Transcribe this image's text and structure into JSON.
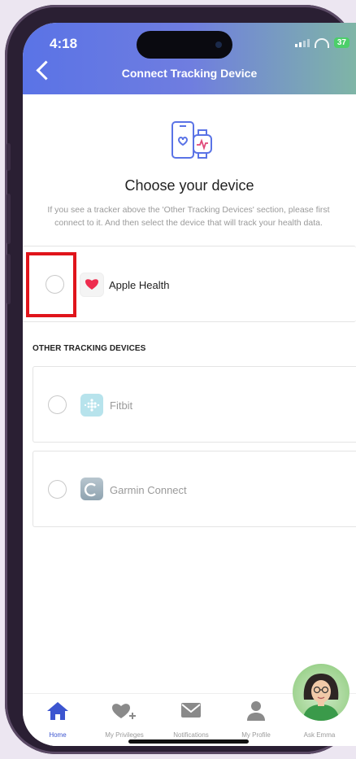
{
  "status_bar": {
    "time": "4:18",
    "battery": "37"
  },
  "header": {
    "title": "Connect Tracking Device"
  },
  "main": {
    "heading": "Choose your device",
    "description": "If you see a tracker above the 'Other Tracking Devices' section, please first connect to it. And then select the device that will track your health data.",
    "primary_device": {
      "label": "Apple Health",
      "selected": false
    },
    "other_section_title": "OTHER TRACKING DEVICES",
    "other_devices": [
      {
        "label": "Fitbit",
        "selected": false
      },
      {
        "label": "Garmin Connect",
        "selected": false
      }
    ]
  },
  "tabbar": {
    "tabs": [
      {
        "label": "Home",
        "icon": "home-icon",
        "active": true
      },
      {
        "label": "My Privileges",
        "icon": "heart-plus-icon",
        "active": false
      },
      {
        "label": "Notifications",
        "icon": "envelope-icon",
        "active": false
      },
      {
        "label": "My Profile",
        "icon": "person-icon",
        "active": false
      },
      {
        "label": "Ask Emma",
        "icon": "assistant-avatar",
        "active": false
      }
    ]
  },
  "colors": {
    "header_gradient_start": "#5a73e6",
    "header_gradient_end": "#7fb5a6",
    "active_tab": "#3c55d0",
    "highlight": "#e0141b"
  }
}
